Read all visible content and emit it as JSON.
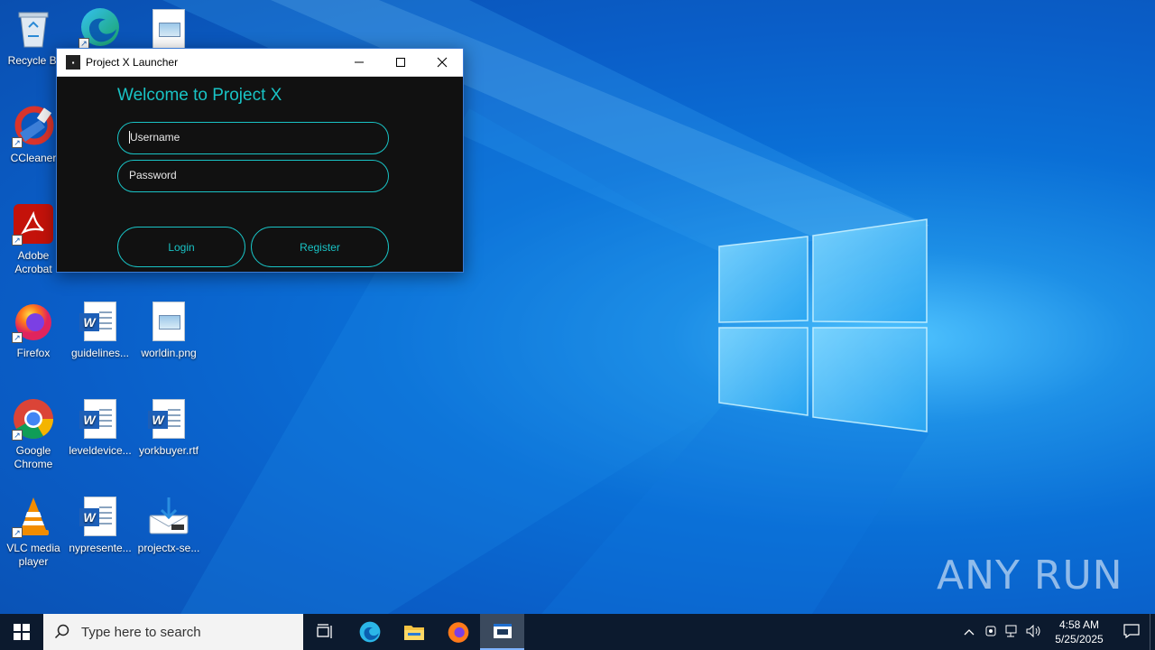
{
  "desktop": {
    "icons": [
      {
        "label": "Recycle Bin",
        "icon": "recycle-bin-icon"
      },
      {
        "label": "CCleaner",
        "icon": "ccleaner-icon"
      },
      {
        "label": "Adobe Acrobat",
        "icon": "adobe-acrobat-icon"
      },
      {
        "label": "Firefox",
        "icon": "firefox-icon"
      },
      {
        "label": "Google Chrome",
        "icon": "chrome-icon"
      },
      {
        "label": "VLC media player",
        "icon": "vlc-icon"
      },
      {
        "label": "guidelines...",
        "icon": "word-document-icon"
      },
      {
        "label": "leveldevice...",
        "icon": "word-document-icon"
      },
      {
        "label": "nypresente...",
        "icon": "word-document-icon"
      },
      {
        "label": "worldin.png",
        "icon": "image-file-icon"
      },
      {
        "label": "yorkbuyer.rtf",
        "icon": "word-document-icon"
      },
      {
        "label": "projectx-se...",
        "icon": "installer-icon"
      }
    ],
    "recycle_label": "Recycle Bi",
    "ccleaner_label": "CCleaner",
    "acrobat_label_1": "Adobe",
    "acrobat_label_2": "Acrobat",
    "firefox_label": "Firefox",
    "chrome_label_1": "Google",
    "chrome_label_2": "Chrome",
    "vlc_label_1": "VLC media",
    "vlc_label_2": "player",
    "watermark": "ANY RUN"
  },
  "window": {
    "title": "Project X Launcher",
    "minimize_symbol": "—",
    "maximize_symbol": "☐",
    "close_symbol": "✕",
    "welcome": "Welcome to Project X",
    "username_placeholder": "Username",
    "password_placeholder": "Password",
    "login_label": "Login",
    "register_label": "Register",
    "accent_color": "#19c3c5",
    "background_color": "#111111"
  },
  "taskbar": {
    "search_placeholder": "Type here to search",
    "time": "4:58 AM",
    "date": "5/25/2025",
    "items": [
      "task-view",
      "edge",
      "file-explorer",
      "firefox",
      "project-x-launcher"
    ]
  }
}
